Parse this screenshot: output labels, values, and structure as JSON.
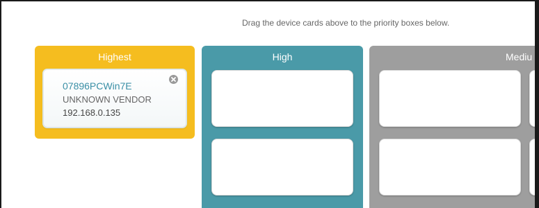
{
  "instruction": "Drag the device cards above to the priority boxes below.",
  "priority_boxes": [
    {
      "title": "Highest",
      "color": "#f5bd1f"
    },
    {
      "title": "High",
      "color": "#4a9aa8"
    },
    {
      "title": "Mediu",
      "color": "#9e9e9e"
    }
  ],
  "device_card": {
    "name": "07896PCWin7E",
    "vendor": "UNKNOWN VENDOR",
    "ip": "192.168.0.135",
    "close_icon": "close-circle-icon"
  }
}
